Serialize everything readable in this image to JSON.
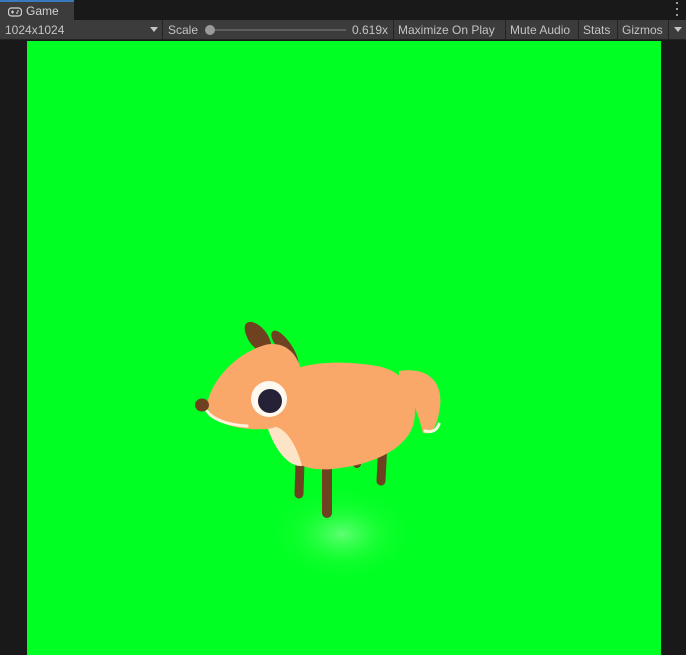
{
  "tab": {
    "label": "Game",
    "icon": "gamepad-icon"
  },
  "toolbar": {
    "resolution": "1024x1024",
    "scale_label": "Scale",
    "scale_value": "0.619x",
    "scale_fraction": 0.0,
    "maximize_label": "Maximize On Play",
    "mute_label": "Mute Audio",
    "stats_label": "Stats",
    "gizmos_label": "Gizmos"
  },
  "colors": {
    "background": "#00ff22",
    "deer_body": "#f9a86a",
    "deer_legs": "#6e4121",
    "accent_tab": "#3a79bb"
  }
}
